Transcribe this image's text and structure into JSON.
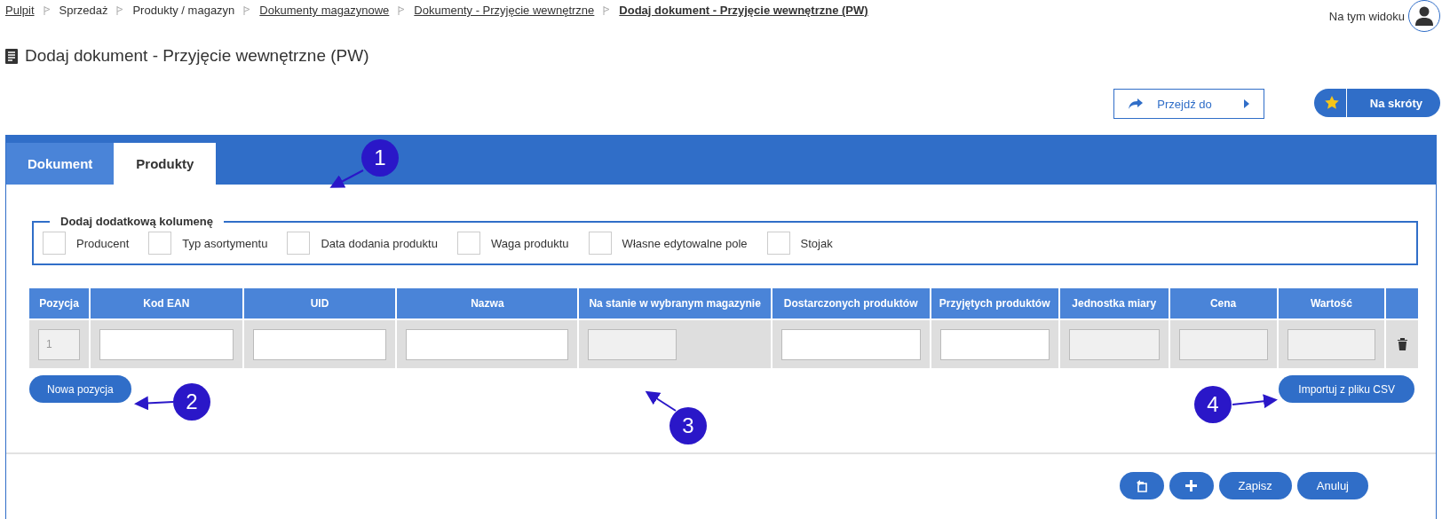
{
  "breadcrumbs": [
    {
      "label": "Pulpit",
      "kind": "link"
    },
    {
      "label": "Sprzedaż",
      "kind": "plain"
    },
    {
      "label": "Produkty / magazyn",
      "kind": "plain"
    },
    {
      "label": "Dokumenty magazynowe",
      "kind": "link"
    },
    {
      "label": "Dokumenty - Przyjęcie wewnętrzne",
      "kind": "link"
    },
    {
      "label": "Dodaj dokument - Przyjęcie wewnętrzne (PW)",
      "kind": "current"
    }
  ],
  "user_menu": {
    "label": "Na tym widoku"
  },
  "page_title": "Dodaj dokument - Przyjęcie wewnętrzne (PW)",
  "actions": [
    {
      "label": "Przejdź do",
      "kind": "goto"
    },
    {
      "label": "Na skróty",
      "kind": "shortcut"
    }
  ],
  "tabs": [
    {
      "label": "Dokument",
      "selected": false
    },
    {
      "label": "Produkty",
      "selected": true
    }
  ],
  "column_options": {
    "legend": "Dodaj dodatkową kolumenę",
    "options": [
      {
        "label": "Producent",
        "checked": false
      },
      {
        "label": "Typ asortymentu",
        "checked": false
      },
      {
        "label": "Data dodania produktu",
        "checked": false
      },
      {
        "label": "Waga produktu",
        "checked": false
      },
      {
        "label": "Własne edytowalne pole",
        "checked": false
      },
      {
        "label": "Stojak",
        "checked": false
      }
    ]
  },
  "table": {
    "columns": [
      "Pozycja",
      "Kod EAN",
      "UID",
      "Nazwa",
      "Na stanie w wybranym magazynie",
      "Dostarczonych produktów",
      "Przyjętych produktów",
      "Jednostka miary",
      "Cena",
      "Wartość"
    ],
    "rows": [
      {
        "cells": [
          {
            "kind": "readonly",
            "value": "1"
          },
          {
            "kind": "input"
          },
          {
            "kind": "input"
          },
          {
            "kind": "input"
          },
          {
            "kind": "readonly"
          },
          {
            "kind": "input"
          },
          {
            "kind": "input"
          },
          {
            "kind": "readonly"
          },
          {
            "kind": "readonly"
          },
          {
            "kind": "readonly"
          },
          {
            "kind": "delete"
          }
        ]
      }
    ]
  },
  "add_row_button": "Nowa pozycja",
  "import_button": "Importuj z pliku CSV",
  "footer_buttons": [
    {
      "kind": "restore"
    },
    {
      "kind": "add"
    },
    {
      "kind": "text",
      "label": "Zapisz"
    },
    {
      "kind": "text",
      "label": "Anuluj"
    }
  ],
  "callouts": [
    {
      "number": "1"
    },
    {
      "number": "2"
    },
    {
      "number": "3"
    },
    {
      "number": "4"
    }
  ]
}
